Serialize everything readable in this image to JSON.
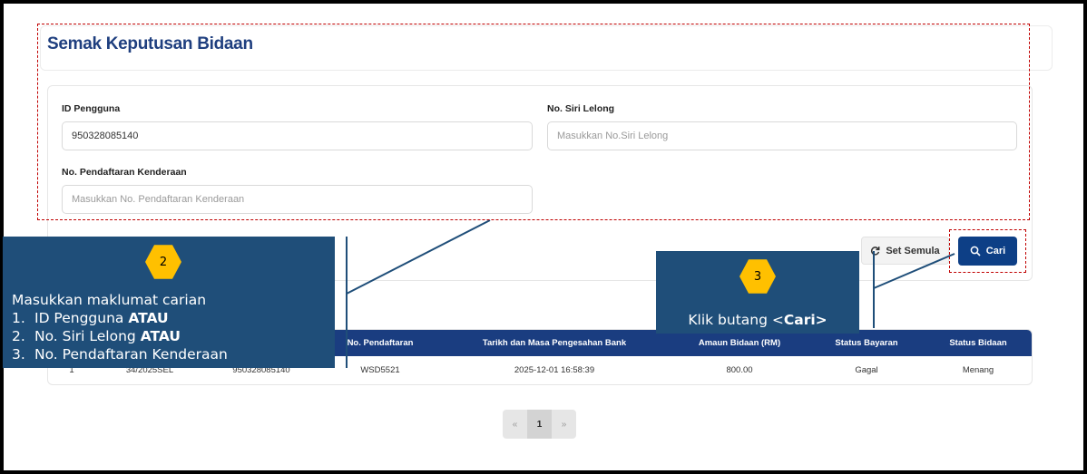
{
  "page": {
    "title": "Semak Keputusan Bidaan"
  },
  "form": {
    "id_pengguna": {
      "label": "ID Pengguna",
      "value": "950328085140",
      "placeholder": ""
    },
    "no_siri_lelong": {
      "label": "No. Siri Lelong",
      "value": "",
      "placeholder": "Masukkan No.Siri Lelong"
    },
    "no_pendaftaran": {
      "label": "No. Pendaftaran Kenderaan",
      "value": "",
      "placeholder": "Masukkan No. Pendaftaran Kenderaan"
    }
  },
  "buttons": {
    "reset_label": "Set Semula",
    "search_label": "Cari"
  },
  "table": {
    "headers": [
      "No. Pendaftaran",
      "Tarikh dan Masa Pengesahan Bank",
      "Amaun Bidaan (RM)",
      "Status Bayaran",
      "Status Bidaan"
    ],
    "partial_row": [
      "1",
      "34/2025SEL",
      "950328085140"
    ],
    "row": [
      "WSD5521",
      "2025-12-01 16:58:39",
      "800.00",
      "Gagal",
      "Menang"
    ]
  },
  "pagination": {
    "prev": "«",
    "current": "1",
    "next": "»"
  },
  "callouts": {
    "step2": {
      "badge": "2",
      "title": "Masukkan maklumat carian",
      "items": [
        {
          "num": "1.",
          "text": "ID Pengguna ",
          "emph": "ATAU"
        },
        {
          "num": "2.",
          "text": "No. Siri Lelong ",
          "emph": "ATAU"
        },
        {
          "num": "3.",
          "text": "No. Pendaftaran Kenderaan",
          "emph": ""
        }
      ]
    },
    "step3": {
      "badge": "3",
      "text_before": "Klik butang <",
      "text_emph": "Cari>"
    }
  },
  "colors": {
    "title": "#1f3f7f",
    "primary_button": "#0d3f86",
    "table_header": "#1a3d80",
    "callout_bg": "#1f4e79",
    "badge": "#ffc000",
    "highlight": "#c00000"
  },
  "icons": {
    "reset": "refresh-icon",
    "search": "search-icon"
  }
}
